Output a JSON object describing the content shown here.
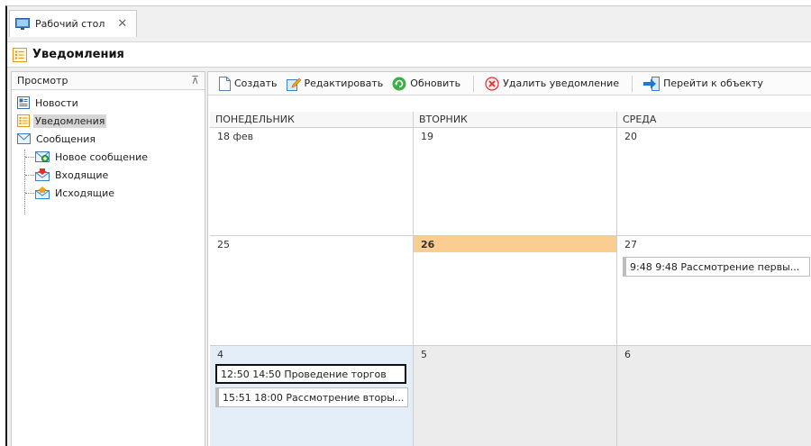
{
  "tab": {
    "label": "Рабочий стол",
    "close": "✕"
  },
  "header": {
    "title": "Уведомления"
  },
  "left": {
    "title": "Просмотр",
    "pin": "⊼",
    "items": [
      {
        "label": "Новости"
      },
      {
        "label": "Уведомления"
      },
      {
        "label": "Сообщения"
      },
      {
        "label": "Новое сообщение"
      },
      {
        "label": "Входящие"
      },
      {
        "label": "Исходящие"
      }
    ]
  },
  "toolbar": {
    "create": "Создать",
    "edit": "Редактировать",
    "refresh": "Обновить",
    "delete": "Удалить уведомление",
    "goto": "Перейти к объекту"
  },
  "calendar": {
    "days": [
      "ПОНЕДЕЛЬНИК",
      "ВТОРНИК",
      "СРЕДА"
    ],
    "weeks": [
      {
        "dates": [
          "18 фев",
          "19",
          "20"
        ]
      },
      {
        "dates": [
          "25",
          "26",
          "27"
        ]
      },
      {
        "dates": [
          "4",
          "5",
          "6"
        ]
      }
    ],
    "events": {
      "wed27": "9:48  9:48 Рассмотрение первы...",
      "mon4a": "12:50 14:50 Проведение торгов",
      "mon4b": "15:51 18:00 Рассмотрение вторы..."
    }
  },
  "colors": {
    "today": "#fccd90",
    "selected_cell": "#e3eef9"
  }
}
